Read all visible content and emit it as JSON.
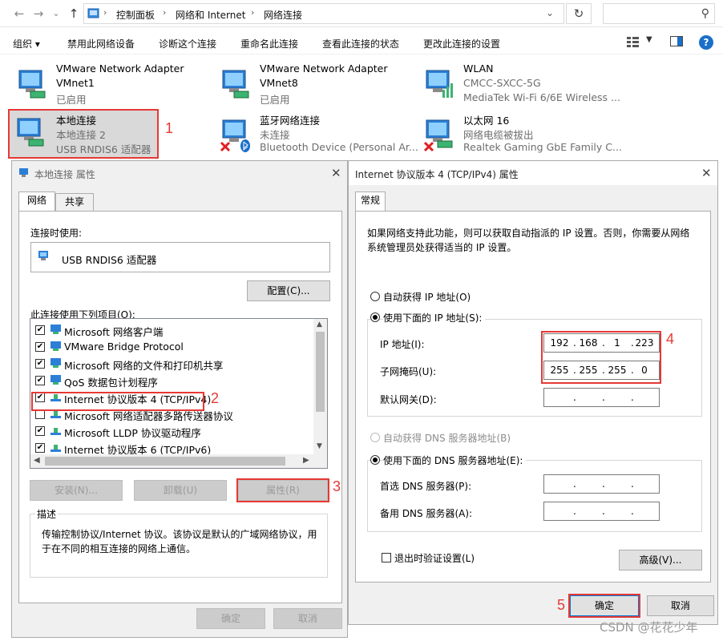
{
  "address": {
    "breadcrumbs": [
      "控制面板",
      "网络和 Internet",
      "网络连接"
    ],
    "search_placeholder": ""
  },
  "commands": {
    "organize": "组织 ▾",
    "disable": "禁用此网络设备",
    "diagnose": "诊断这个连接",
    "rename": "重命名此连接",
    "status": "查看此连接的状态",
    "change": "更改此连接的设置"
  },
  "adapters": [
    {
      "name": "VMware Network Adapter",
      "line2": "VMnet1",
      "line3": "已启用"
    },
    {
      "name": "VMware Network Adapter",
      "line2": "VMnet8",
      "line3": "已启用"
    },
    {
      "name": "WLAN",
      "line2": "CMCC-SXCC-5G",
      "line3": "MediaTek Wi-Fi 6/6E Wireless ..."
    },
    {
      "name": "本地连接",
      "line2": "本地连接 2",
      "line3": "USB RNDIS6 适配器"
    },
    {
      "name": "蓝牙网络连接",
      "line2": "未连接",
      "line3": "Bluetooth Device (Personal Ar..."
    },
    {
      "name": "以太网 16",
      "line2": "网络电缆被拔出",
      "line3": "Realtek Gaming GbE Family C..."
    }
  ],
  "props_dialog": {
    "title": "本地连接 属性",
    "tabs": [
      "网络",
      "共享"
    ],
    "connect_using_label": "连接时使用:",
    "adapter_name": "USB RNDIS6 适配器",
    "configure_button": "配置(C)...",
    "items_label": "此连接使用下列项目(O):",
    "items": [
      {
        "checked": true,
        "label": "Microsoft 网络客户端"
      },
      {
        "checked": true,
        "label": "VMware Bridge Protocol"
      },
      {
        "checked": true,
        "label": "Microsoft 网络的文件和打印机共享"
      },
      {
        "checked": true,
        "label": "QoS 数据包计划程序"
      },
      {
        "checked": true,
        "label": "Internet 协议版本 4 (TCP/IPv4)"
      },
      {
        "checked": false,
        "label": "Microsoft 网络适配器多路传送器协议"
      },
      {
        "checked": true,
        "label": "Microsoft LLDP 协议驱动程序"
      },
      {
        "checked": true,
        "label": "Internet 协议版本 6 (TCP/IPv6)"
      }
    ],
    "install_button": "安装(N)...",
    "uninstall_button": "卸载(U)",
    "properties_button": "属性(R)",
    "description_title": "描述",
    "description_text": "传输控制协议/Internet 协议。该协议是默认的广域网络协议，用于在不同的相互连接的网络上通信。",
    "ok_button": "确定",
    "cancel_button": "取消"
  },
  "ipv4_dialog": {
    "title": "Internet 协议版本 4 (TCP/IPv4) 属性",
    "tab": "常规",
    "intro": "如果网络支持此功能，则可以获取自动指派的 IP 设置。否则，你需要从网络系统管理员处获得适当的 IP 设置。",
    "auto_ip": "自动获得 IP 地址(O)",
    "manual_ip": "使用下面的 IP 地址(S):",
    "ip_label": "IP 地址(I):",
    "ip_value": [
      "192",
      "168",
      "1",
      "223"
    ],
    "mask_label": "子网掩码(U):",
    "mask_value": [
      "255",
      "255",
      "255",
      "0"
    ],
    "gateway_label": "默认网关(D):",
    "auto_dns": "自动获得 DNS 服务器地址(B)",
    "manual_dns": "使用下面的 DNS 服务器地址(E):",
    "dns1_label": "首选 DNS 服务器(P):",
    "dns2_label": "备用 DNS 服务器(A):",
    "validate_label": "退出时验证设置(L)",
    "advanced_button": "高级(V)...",
    "ok_button": "确定",
    "cancel_button": "取消"
  },
  "annotations": [
    "1",
    "2",
    "3",
    "4",
    "5"
  ],
  "watermark": "CSDN @花花少年",
  "colors": {
    "annotation": "#e53935",
    "accent": "#0078d7"
  }
}
